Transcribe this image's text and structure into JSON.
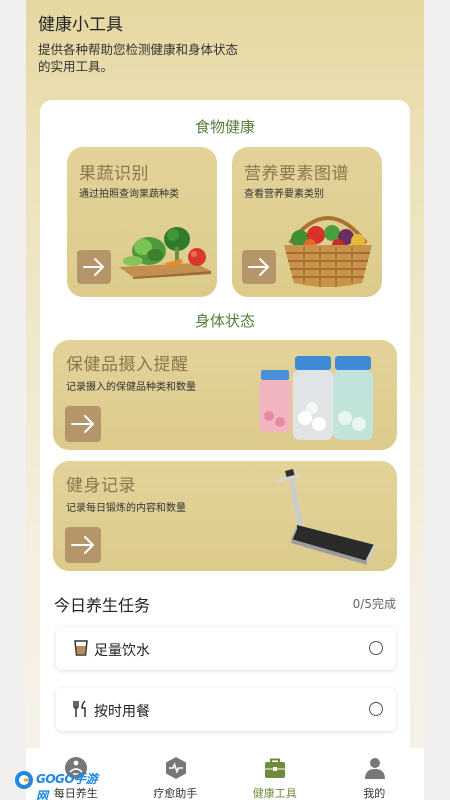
{
  "header": {
    "title": "健康小工具",
    "description": "提供各种帮助您检测健康和身体状态的实用工具。"
  },
  "food_section": {
    "title": "食物健康",
    "tiles": [
      {
        "title": "果蔬识别",
        "desc": "通过拍照查询果蔬种类",
        "icon": "arrow-right-icon"
      },
      {
        "title": "营养要素图谱",
        "desc": "查看营养要素类别",
        "icon": "arrow-right-icon"
      }
    ]
  },
  "body_section": {
    "title": "身体状态",
    "tiles": [
      {
        "title": "保健品摄入提醒",
        "desc": "记录摄入的保健品种类和数量",
        "icon": "arrow-right-icon"
      },
      {
        "title": "健身记录",
        "desc": "记录每日锻炼的内容和数量",
        "icon": "arrow-right-icon"
      }
    ]
  },
  "tasks": {
    "title": "今日养生任务",
    "progress": "0/5完成",
    "items": [
      {
        "label": "足量饮水",
        "icon": "cup-icon",
        "done": false
      },
      {
        "label": "按时用餐",
        "icon": "utensils-icon",
        "done": false
      }
    ]
  },
  "tabbar": {
    "active": 2,
    "items": [
      {
        "label": "每日养生",
        "icon": "person-meditate-icon"
      },
      {
        "label": "疗愈助手",
        "icon": "pulse-icon"
      },
      {
        "label": "健康工具",
        "icon": "briefcase-icon"
      },
      {
        "label": "我的",
        "icon": "user-icon"
      }
    ]
  },
  "watermark": {
    "text": "GOGO手游网"
  },
  "colors": {
    "accent_green": "#6f8c3b",
    "section_title": "#5a7c3a",
    "tile_bg": "#dccb8b",
    "arrow_btn": "#b4966a",
    "tile_title": "#8a7650"
  }
}
